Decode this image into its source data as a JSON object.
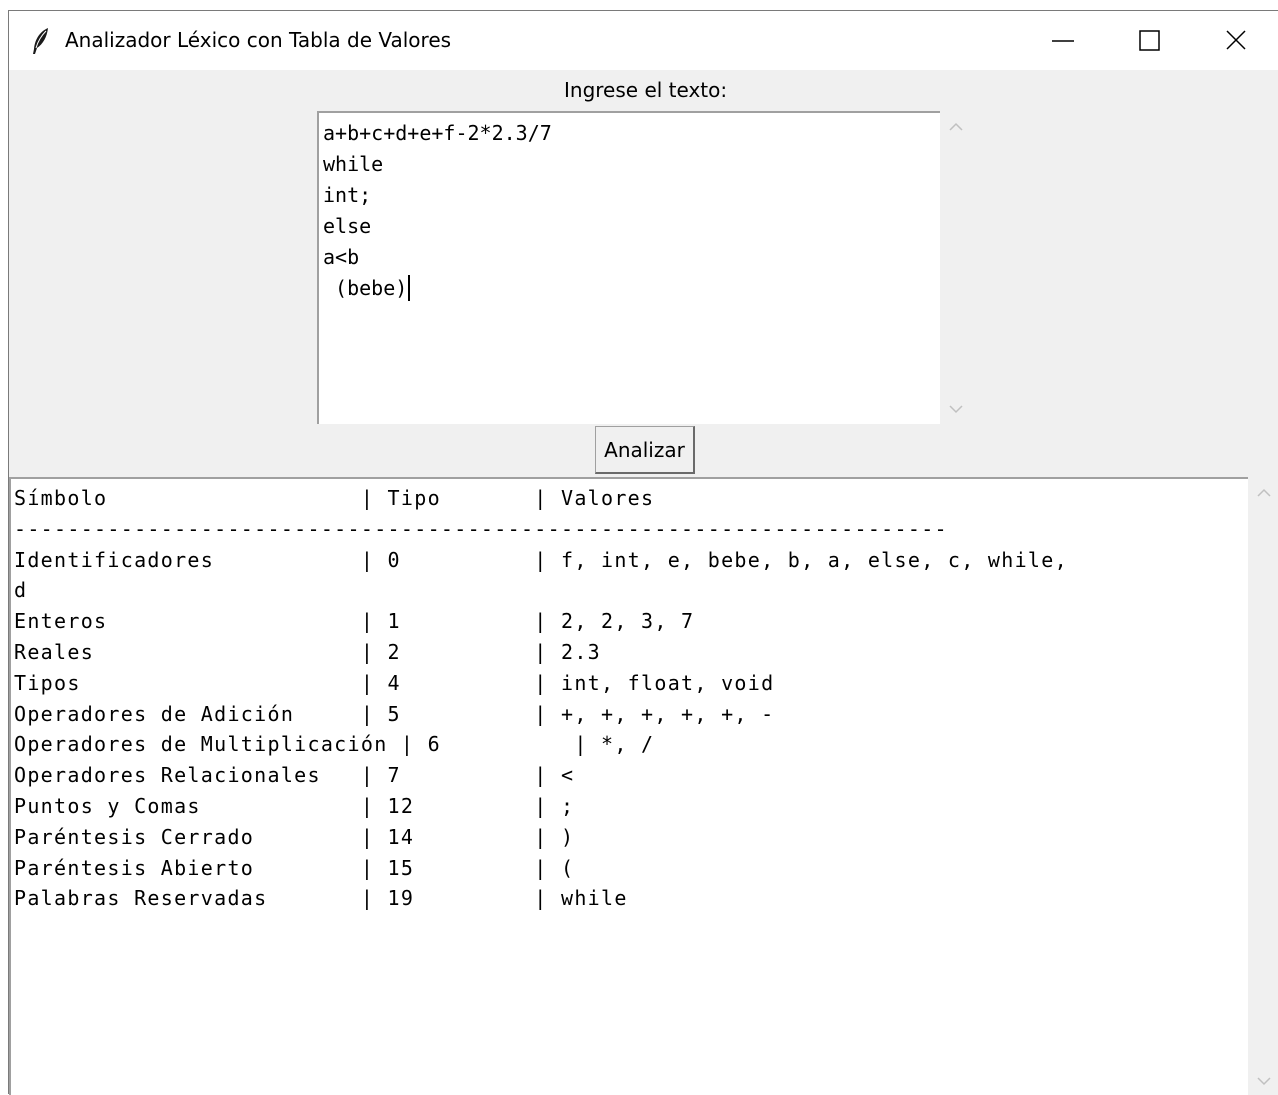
{
  "window": {
    "title": "Analizador Léxico con Tabla de Valores",
    "icon": "feather-icon",
    "controls": [
      "minimize-icon",
      "maximize-icon",
      "close-icon"
    ]
  },
  "input": {
    "label": "Ingrese el texto:",
    "value": "a+b+c+d+e+f-2*2.3/7\nwhile\nint;\nelse\na<b\n (bebe)"
  },
  "analyze_button": {
    "label": "Analizar"
  },
  "output": {
    "lines": [
      "Símbolo                   | Tipo       | Valores",
      "----------------------------------------------------------------------",
      "Identificadores           | 0          | f, int, e, bebe, b, a, else, c, while,",
      "d",
      "Enteros                   | 1          | 2, 2, 3, 7",
      "Reales                    | 2          | 2.3",
      "Tipos                     | 4          | int, float, void",
      "Operadores de Adición     | 5          | +, +, +, +, +, -",
      "Operadores de Multiplicación | 6          | *, /",
      "Operadores Relacionales   | 7          | <",
      "Puntos y Comas            | 12         | ;",
      "Paréntesis Cerrado        | 14         | )",
      "Paréntesis Abierto        | 15         | (",
      "Palabras Reservadas       | 19         | while"
    ]
  }
}
